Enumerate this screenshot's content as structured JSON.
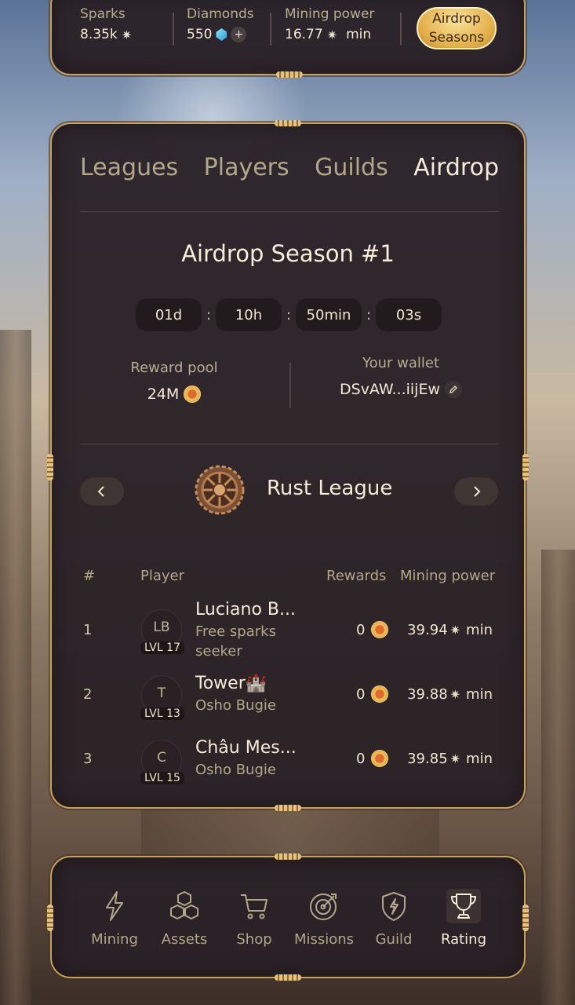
{
  "stats": {
    "sparks_label": "Sparks",
    "sparks_value": "8.35k",
    "diamonds_label": "Diamonds",
    "diamonds_value": "550",
    "add_symbol": "+",
    "mining_label": "Mining power",
    "mining_value": "16.77",
    "mining_unit": "min",
    "airdrop_button_line1": "Airdrop",
    "airdrop_button_line2": "Seasons"
  },
  "tabs": [
    {
      "label": "Leagues",
      "active": false
    },
    {
      "label": "Players",
      "active": false
    },
    {
      "label": "Guilds",
      "active": false
    },
    {
      "label": "Airdrop",
      "active": true
    }
  ],
  "season": {
    "title": "Airdrop Season #1",
    "timer": [
      "01d",
      "10h",
      "50min",
      "03s"
    ],
    "colon": ":",
    "reward_pool_label": "Reward pool",
    "reward_pool_value": "24M",
    "wallet_label": "Your wallet",
    "wallet_value": "DSvAW...iijEw"
  },
  "league": {
    "name": "Rust League"
  },
  "table": {
    "headers": {
      "rank": "#",
      "player": "Player",
      "rewards": "Rewards",
      "mining": "Mining power"
    },
    "unit": "min",
    "rows": [
      {
        "rank": "1",
        "initials": "LB",
        "level": "LVL 17",
        "name": "Luciano B...",
        "guild": "Free sparks seeker",
        "reward": "0",
        "mining": "39.94"
      },
      {
        "rank": "2",
        "initials": "T",
        "level": "LVL 13",
        "name": "Tower🏰",
        "guild": "Osho Bugie",
        "reward": "0",
        "mining": "39.88"
      },
      {
        "rank": "3",
        "initials": "C",
        "level": "LVL 15",
        "name": "Châu Mes...",
        "guild": "Osho Bugie",
        "reward": "0",
        "mining": "39.85"
      }
    ]
  },
  "nav": [
    {
      "label": "Mining",
      "icon": "lightning-icon",
      "active": false
    },
    {
      "label": "Assets",
      "icon": "cubes-icon",
      "active": false
    },
    {
      "label": "Shop",
      "icon": "cart-icon",
      "active": false
    },
    {
      "label": "Missions",
      "icon": "target-icon",
      "active": false
    },
    {
      "label": "Guild",
      "icon": "shield-icon",
      "active": false
    },
    {
      "label": "Rating",
      "icon": "trophy-icon",
      "active": true
    }
  ],
  "colors": {
    "accent_gold": "#c8a15f",
    "panel": "#2a2126",
    "active_text": "#f4ecd9",
    "muted_text": "#b2a788"
  }
}
